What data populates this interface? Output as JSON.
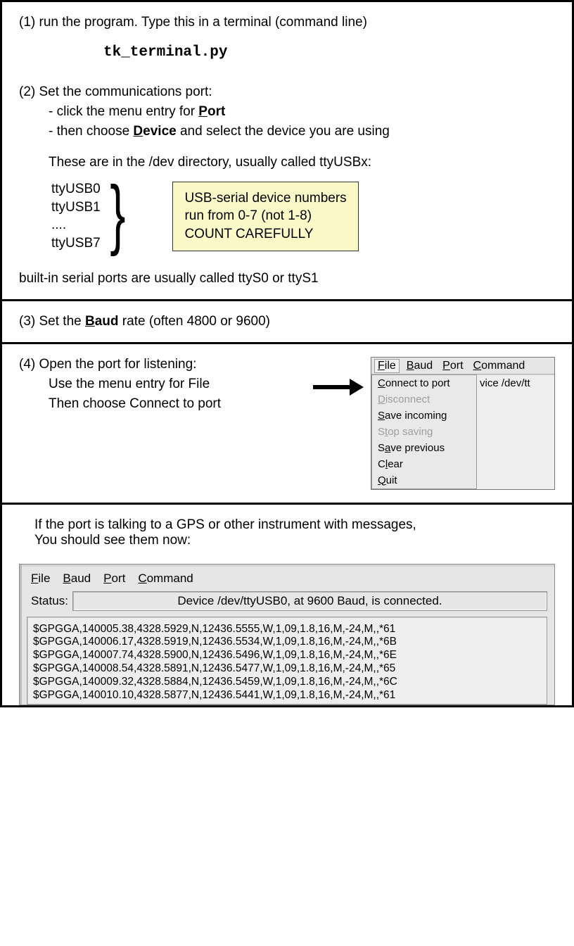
{
  "step1": {
    "text": "(1) run the program.  Type this in a terminal (command line)",
    "command": "tk_terminal.py"
  },
  "step2": {
    "heading": "(2) Set the communications port:",
    "bullet1_a": "- click the menu entry for ",
    "bullet1_b_bold_u": "P",
    "bullet1_c_bold": "ort",
    "bullet2_a": "- then choose ",
    "bullet2_b_bold_u": "D",
    "bullet2_c_bold": "evice",
    "bullet2_d": " and select the device you are using",
    "subtext": "These are in the /dev directory, usually called ttyUSBx:",
    "tty": [
      "ttyUSB0",
      "ttyUSB1",
      "....",
      "ttyUSB7"
    ],
    "callout": [
      "USB-serial device numbers",
      "run from 0-7 (not 1-8)",
      "COUNT CAREFULLY"
    ],
    "below": "built-in serial ports are usually called ttyS0 or ttyS1"
  },
  "step3": {
    "a": "(3) Set the ",
    "b_bold_u": "B",
    "c_bold": "aud",
    "d": " rate (often 4800 or 9600)"
  },
  "step4": {
    "line1": "(4) Open the port for listening:",
    "line2": "Use the menu entry for File",
    "line3": "Then choose Connect to port",
    "menubar": {
      "file_u": "F",
      "file_r": "ile",
      "baud_u": "B",
      "baud_r": "aud",
      "port_u": "P",
      "port_r": "ort",
      "cmd_u": "C",
      "cmd_r": "ommand"
    },
    "side_text": "vice /dev/tt",
    "dropdown": [
      {
        "u": "C",
        "r": "onnect to port",
        "disabled": false
      },
      {
        "u": "D",
        "r": "isconnect",
        "disabled": true
      },
      {
        "u": "S",
        "r": "ave incoming",
        "disabled": false
      },
      {
        "pre": "S",
        "u": "t",
        "r": "op saving",
        "disabled": true
      },
      {
        "pre": "S",
        "u": "a",
        "r": "ve previous",
        "disabled": false
      },
      {
        "pre": "C",
        "u": "l",
        "r": "ear",
        "disabled": false
      },
      {
        "u": "Q",
        "r": "uit",
        "disabled": false
      }
    ]
  },
  "step5": {
    "line1": "If the port is talking to a GPS or other instrument with messages,",
    "line2": "You should see them now:",
    "menubar": {
      "file_u": "F",
      "file_r": "ile",
      "baud_u": "B",
      "baud_r": "aud",
      "port_u": "P",
      "port_r": "ort",
      "cmd_u": "C",
      "cmd_r": "ommand"
    },
    "status_label": "Status:",
    "status_value": "Device /dev/ttyUSB0, at 9600 Baud, is connected.",
    "output": [
      "$GPGGA,140005.38,4328.5929,N,12436.5555,W,1,09,1.8,16,M,-24,M,,*61",
      "$GPGGA,140006.17,4328.5919,N,12436.5534,W,1,09,1.8,16,M,-24,M,,*6B",
      "$GPGGA,140007.74,4328.5900,N,12436.5496,W,1,09,1.8,16,M,-24,M,,*6E",
      "$GPGGA,140008.54,4328.5891,N,12436.5477,W,1,09,1.8,16,M,-24,M,,*65",
      "$GPGGA,140009.32,4328.5884,N,12436.5459,W,1,09,1.8,16,M,-24,M,,*6C",
      "$GPGGA,140010.10,4328.5877,N,12436.5441,W,1,09,1.8,16,M,-24,M,,*61"
    ]
  }
}
